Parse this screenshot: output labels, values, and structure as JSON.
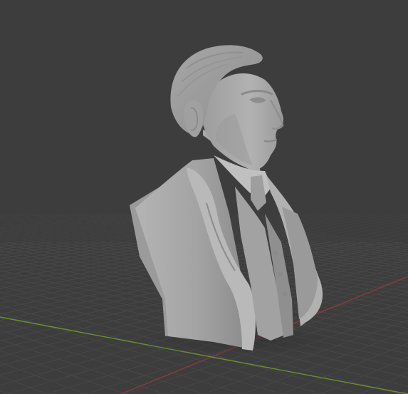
{
  "viewport": {
    "kind": "3d-viewport",
    "background_color": "#3d3d3d",
    "grid_color": "#4a4a4a",
    "x_axis_color": "#8a3a44",
    "y_axis_color": "#6f8f2e",
    "model": {
      "name": "bust-sculpt",
      "material_color": "#a9a9a9"
    }
  }
}
